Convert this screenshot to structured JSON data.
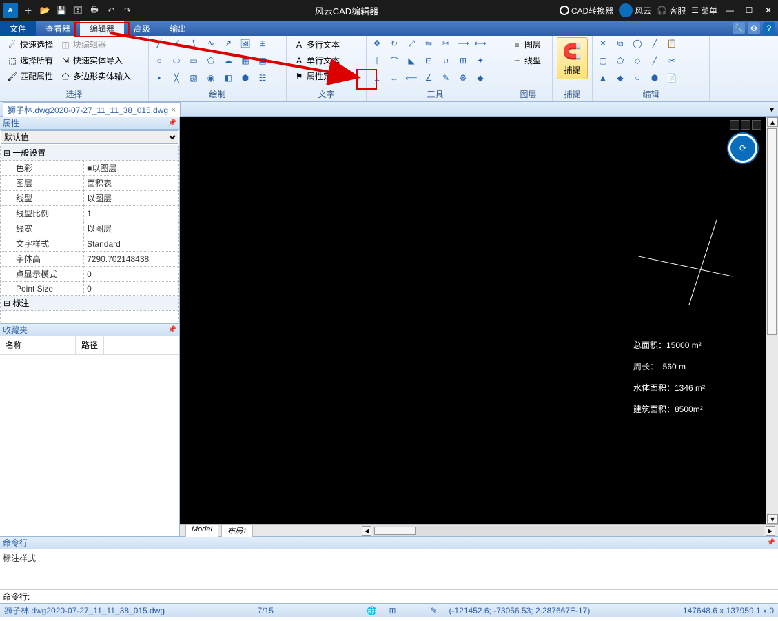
{
  "title": "风云CAD编辑器",
  "titlebar_right": {
    "converter": "CAD转换器",
    "fengyun": "风云",
    "support": "客服",
    "menu": "菜单"
  },
  "menus": {
    "file": "文件",
    "view": "查看器",
    "editor": "编辑器",
    "adv": "高级",
    "output": "输出"
  },
  "ribbon": {
    "select": {
      "label": "选择",
      "quick": "快速选择",
      "all": "选择所有",
      "match": "匹配属性",
      "blkedit": "块编辑器",
      "fastimp": "快速实体导入",
      "polyimp": "多边形实体输入"
    },
    "draw": {
      "label": "绘制"
    },
    "text": {
      "label": "文字",
      "mtext": "多行文本",
      "stext": "单行文本",
      "attdef": "属性定义"
    },
    "tools": {
      "label": "工具"
    },
    "layer": {
      "label": "图层",
      "layers": "图层",
      "ltype": "线型"
    },
    "snap": {
      "label": "捕捉",
      "btn": "捕捉"
    },
    "edit": {
      "label": "编辑"
    }
  },
  "doc_tab": "狮子林.dwg2020-07-27_11_11_38_015.dwg",
  "props": {
    "title": "属性",
    "default": "默认值",
    "grp_general": "一般设置",
    "grp_annot": "标注",
    "rows": [
      {
        "k": "色彩",
        "v": "■以图层"
      },
      {
        "k": "图层",
        "v": "面积表"
      },
      {
        "k": "线型",
        "v": "以图层"
      },
      {
        "k": "线型比例",
        "v": "1"
      },
      {
        "k": "线宽",
        "v": "以图层"
      },
      {
        "k": "文字样式",
        "v": "Standard"
      },
      {
        "k": "字体高",
        "v": "7290.702148438"
      },
      {
        "k": "点显示模式",
        "v": "0"
      },
      {
        "k": "Point Size",
        "v": "0"
      }
    ]
  },
  "fav": {
    "title": "收藏夹",
    "col1": "名称",
    "col2": "路径"
  },
  "canvas_text": {
    "l1": "总面积：15000 m²",
    "l2": "周长：  560 m",
    "l3": "水体面积：1346 m²",
    "l4": "建筑面积：8500m²"
  },
  "layout_tabs": {
    "model": "Model",
    "layout1": "布局1"
  },
  "cmd": {
    "title": "命令行",
    "body": "标注样式",
    "prompt": "命令行:"
  },
  "status": {
    "file": "狮子林.dwg2020-07-27_11_11_38_015.dwg",
    "page": "7/15",
    "coords": "(-121452.6; -73056.53; 2.287667E-17)",
    "size": "147648.6 x 137959.1 x 0"
  }
}
